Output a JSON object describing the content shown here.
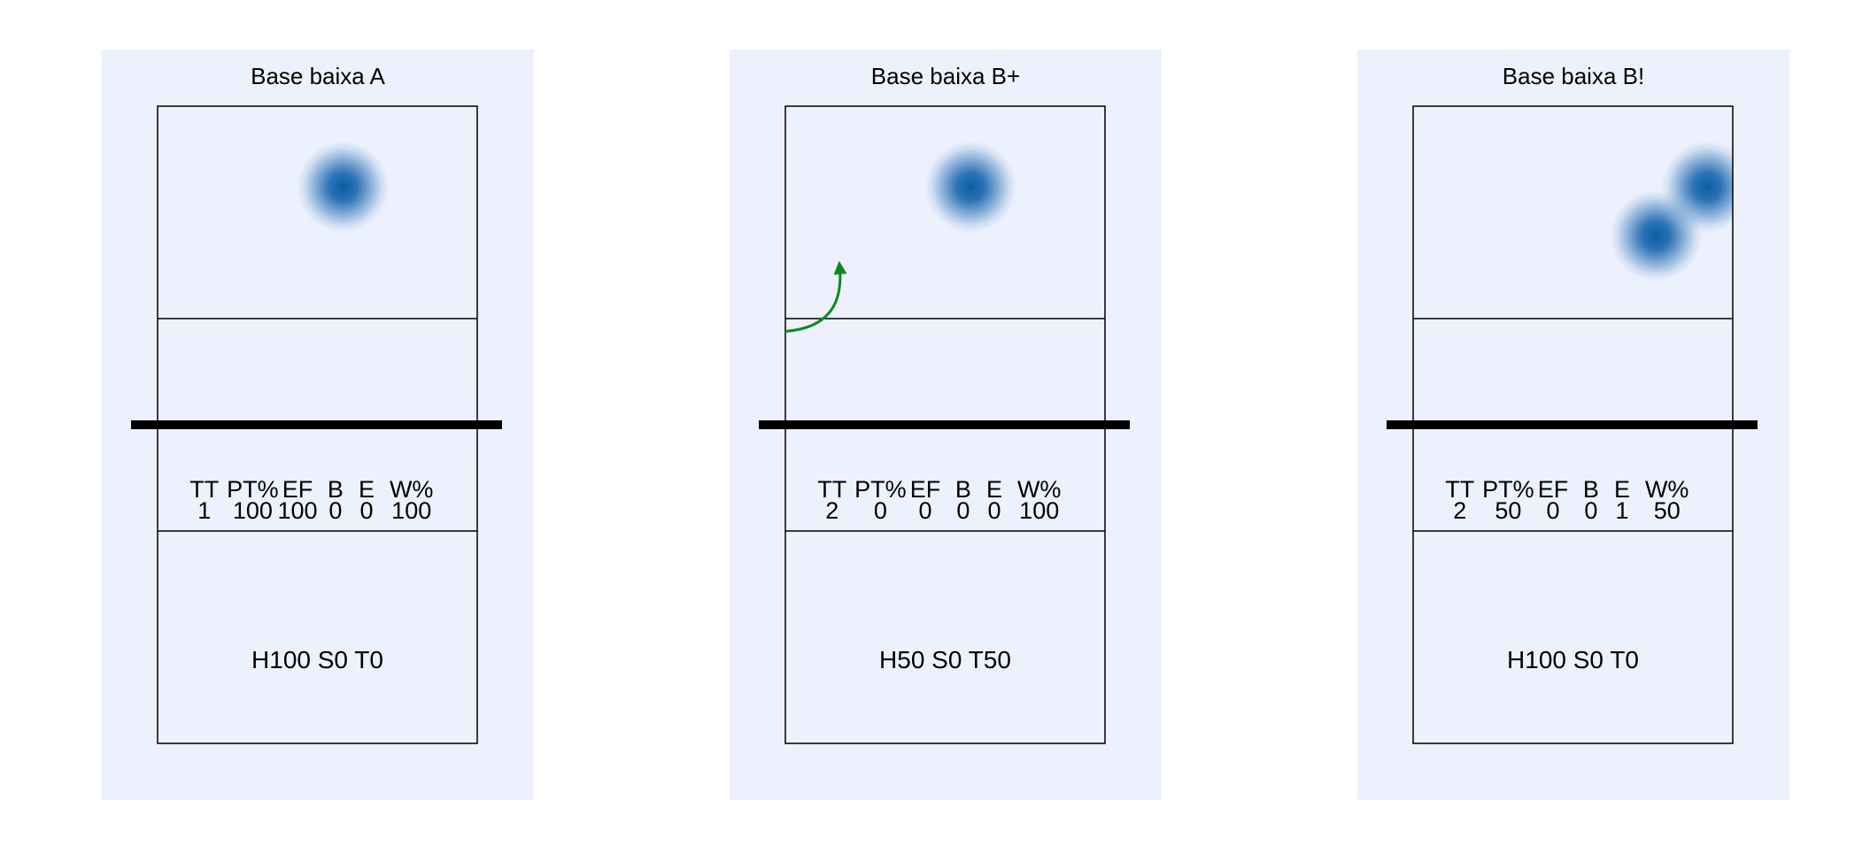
{
  "colors": {
    "panel_bg": "#ecf1fd",
    "court_line": "#000000",
    "net": "#000000",
    "heat": "#0b5ca8",
    "arrow": "#0a8a1e"
  },
  "stat_headers": [
    "TT",
    "PT%",
    "EF",
    "B",
    "E",
    "W%"
  ],
  "chart_data": [
    {
      "type": "heatmap",
      "title": "Base baixa A",
      "stats": {
        "TT": "1",
        "PT%": "100",
        "EF": "100",
        "B": "0",
        "E": "0",
        "W%": "100"
      },
      "footer": "H100 S0 T0",
      "hotspots": [
        {
          "x": 0.58,
          "y": 0.38,
          "intensity": 1
        }
      ],
      "arrows": []
    },
    {
      "type": "heatmap",
      "title": "Base baixa B+",
      "stats": {
        "TT": "2",
        "PT%": "0",
        "EF": "0",
        "B": "0",
        "E": "0",
        "W%": "100"
      },
      "footer": "H50 S0 T50",
      "hotspots": [
        {
          "x": 0.58,
          "y": 0.38,
          "intensity": 1
        }
      ],
      "arrows": [
        {
          "from": {
            "x": 0.0,
            "y": 1.06
          },
          "to": {
            "x": 0.17,
            "y": 0.76
          }
        }
      ]
    },
    {
      "type": "heatmap",
      "title": "Base baixa B!",
      "stats": {
        "TT": "2",
        "PT%": "50",
        "EF": "0",
        "B": "0",
        "E": "1",
        "W%": "50"
      },
      "footer": "H100 S0 T0",
      "hotspots": [
        {
          "x": 0.92,
          "y": 0.38,
          "intensity": 1
        },
        {
          "x": 0.76,
          "y": 0.61,
          "intensity": 1
        }
      ],
      "arrows": []
    }
  ]
}
